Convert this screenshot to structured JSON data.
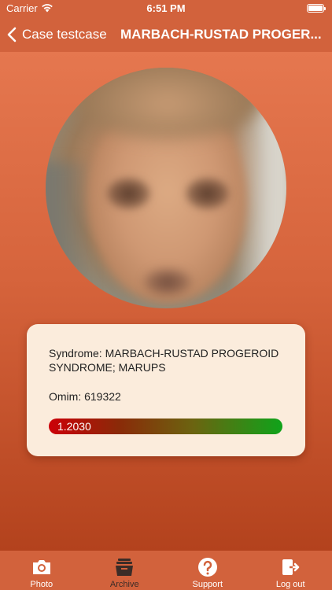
{
  "status_bar": {
    "carrier": "Carrier",
    "time": "6:51 PM"
  },
  "nav": {
    "back_label": "Case testcase",
    "title": "MARBACH-RUSTAD PROGER..."
  },
  "result": {
    "syndrome": "Syndrome: MARBACH-RUSTAD PROGEROID SYNDROME; MARUPS",
    "omim": "Omim: 619322",
    "score_label": "1.2030"
  },
  "tabs": [
    {
      "label": "Photo",
      "icon": "camera-icon"
    },
    {
      "label": "Archive",
      "icon": "archive-icon"
    },
    {
      "label": "Support",
      "icon": "question-icon"
    },
    {
      "label": "Log out",
      "icon": "logout-icon"
    }
  ],
  "colors": {
    "accent": "#d2623c",
    "card": "#fbecdc",
    "score_low": "#cc0008",
    "score_high": "#0fa31a"
  }
}
